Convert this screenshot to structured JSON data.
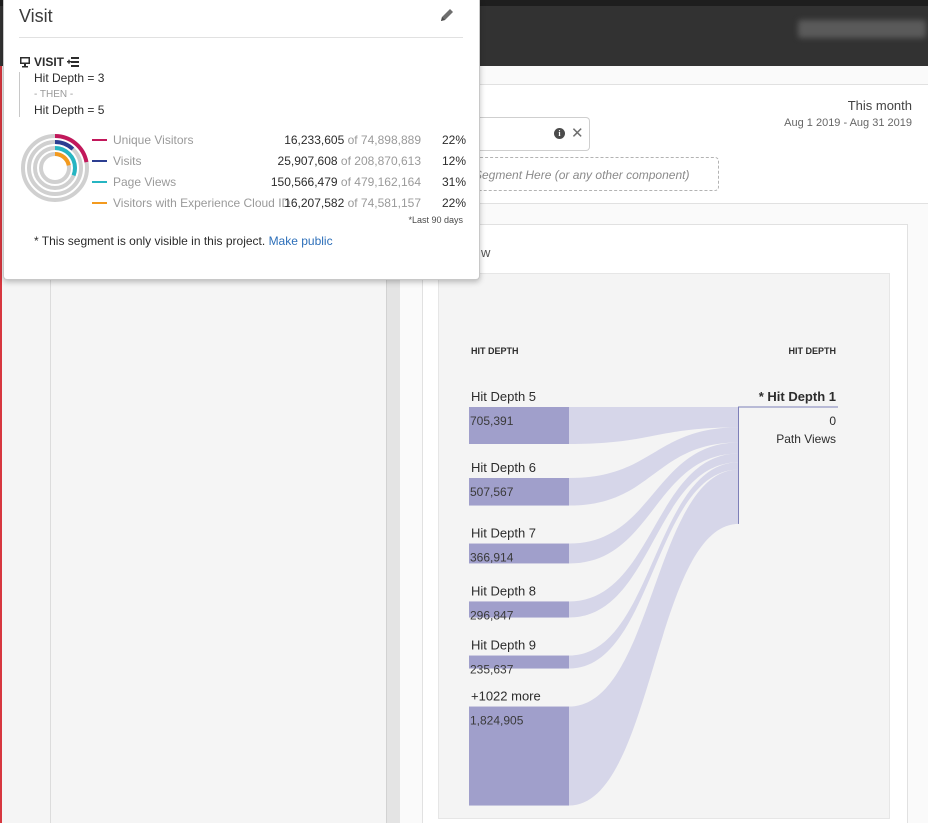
{
  "popover": {
    "title": "Visit",
    "definition": {
      "container_label": "VISIT",
      "step1": "Hit Depth = 3",
      "then_label": "- THEN -",
      "step2": "Hit Depth = 5"
    },
    "metrics": [
      {
        "name": "Unique Visitors",
        "value": "16,233,605",
        "of_label": "of 74,898,889",
        "percent": "22%",
        "color": "#c2185b"
      },
      {
        "name": "Visits",
        "value": "25,907,608",
        "of_label": "of 208,870,613",
        "percent": "12%",
        "color": "#2c3e91"
      },
      {
        "name": "Page Views",
        "value": "150,566,479",
        "of_label": "of 479,162,164",
        "percent": "31%",
        "color": "#26b5c2"
      },
      {
        "name": "Visitors with Experience Cloud ID",
        "value": "16,207,582",
        "of_label": "of 74,581,157",
        "percent": "22%",
        "color": "#f39a1e"
      }
    ],
    "last_days_note": "*Last 90 days",
    "visibility_note": "* This segment is only visible in this project.",
    "make_public_link": "Make public"
  },
  "header": {
    "date_title": "This month",
    "date_range": "Aug 1 2019 - Aug 31 2019"
  },
  "segment_bar": {
    "drop_zone_text": "Segment Here (or any other component)"
  },
  "panel": {
    "title_fragment": "w"
  },
  "flow": {
    "left_header": "HIT DEPTH",
    "right_header": "HIT DEPTH",
    "nodes": [
      {
        "label": "Hit Depth 5",
        "value": "705,391",
        "count": 705391
      },
      {
        "label": "Hit Depth 6",
        "value": "507,567",
        "count": 507567
      },
      {
        "label": "Hit Depth 7",
        "value": "366,914",
        "count": 366914
      },
      {
        "label": "Hit Depth 8",
        "value": "296,847",
        "count": 296847
      },
      {
        "label": "Hit Depth 9",
        "value": "235,637",
        "count": 235637
      },
      {
        "label": "+1022 more",
        "value": "1,824,905",
        "count": 1824905
      }
    ],
    "target": {
      "label": "* Hit Depth 1",
      "value": "0",
      "sublabel": "Path Views"
    },
    "colors": {
      "node": "#a09fcb",
      "link": "#d4d4e8",
      "rule": "#7d7fb8"
    }
  },
  "icons": {
    "edit": "pencil-icon",
    "container": "monitor-icon",
    "add_container": "add-container-icon",
    "info": "info-icon",
    "clear": "close-icon",
    "chart": "donut-chart"
  }
}
